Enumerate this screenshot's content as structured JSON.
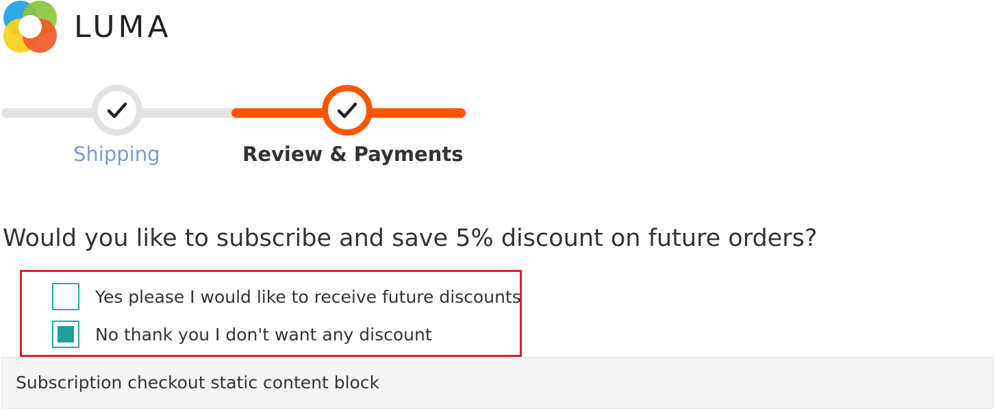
{
  "brand": {
    "name": "LUMA",
    "logo_colors": [
      "#1ea1e1",
      "#8cc63e",
      "#fcd017",
      "#f05a28"
    ]
  },
  "progress": {
    "steps": [
      {
        "label": "Shipping",
        "state": "completed"
      },
      {
        "label": "Review & Payments",
        "state": "active"
      }
    ],
    "accent_color": "#ff5501",
    "inactive_color": "#e3e3e3"
  },
  "subscription": {
    "question": "Would you like to subscribe and save 5% discount on future orders?",
    "options": [
      {
        "label": "Yes please I would like to receive future discounts",
        "checked": false
      },
      {
        "label": "No thank you I don't want any discount",
        "checked": true
      }
    ],
    "highlight_color": "#d0232f",
    "checkbox_color": "#1f9e9e"
  },
  "static_block": {
    "text": "Subscription checkout static content block"
  }
}
